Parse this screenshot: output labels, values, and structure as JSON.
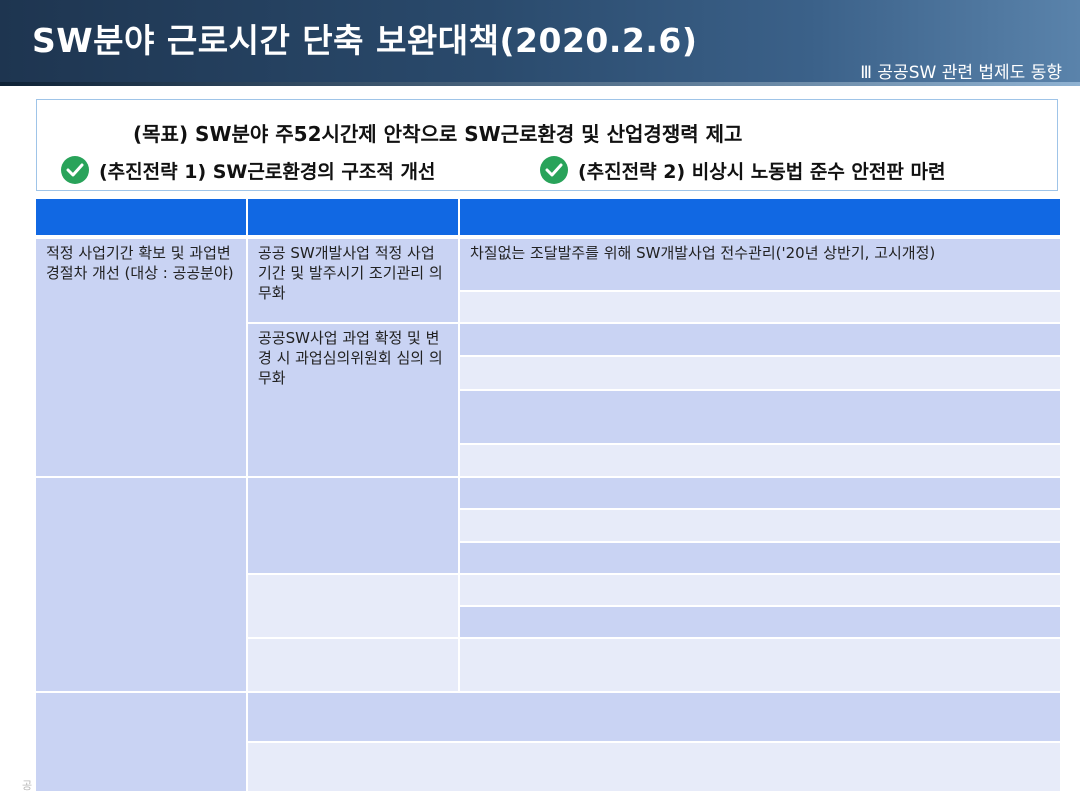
{
  "header": {
    "title": "SW분야 근로시간 단축 보완대책(2020.2.6)",
    "section": "Ⅲ 공공SW 관련 법제도 동향"
  },
  "goal": {
    "text": "(목표) SW분야 주52시간제 안착으로 SW근로환경 및 산업경쟁력 제고",
    "strategy1": "(추진전략 1) SW근로환경의 구조적 개선",
    "strategy2": "(추진전략 2) 비상시 노동법 준수 안전판 마련",
    "check_color": "#29a35a"
  },
  "table": {
    "header_color": "#1168e3",
    "group1_title": "적정 사업기간 확보 및 과업변경절차 개선 (대상 : 공공분야)",
    "item1": "공공 SW개발사업 적정 사업기간 및 발주시기 조기관리 의무화",
    "item2": "공공SW사업 과업 확정 및 변경 시 과업심의위원회 심의 의무화",
    "detail1": "차질없는 조달발주를 위해 SW개발사업 전수관리('20년 상반기, 고시개정)"
  },
  "footer": "공"
}
